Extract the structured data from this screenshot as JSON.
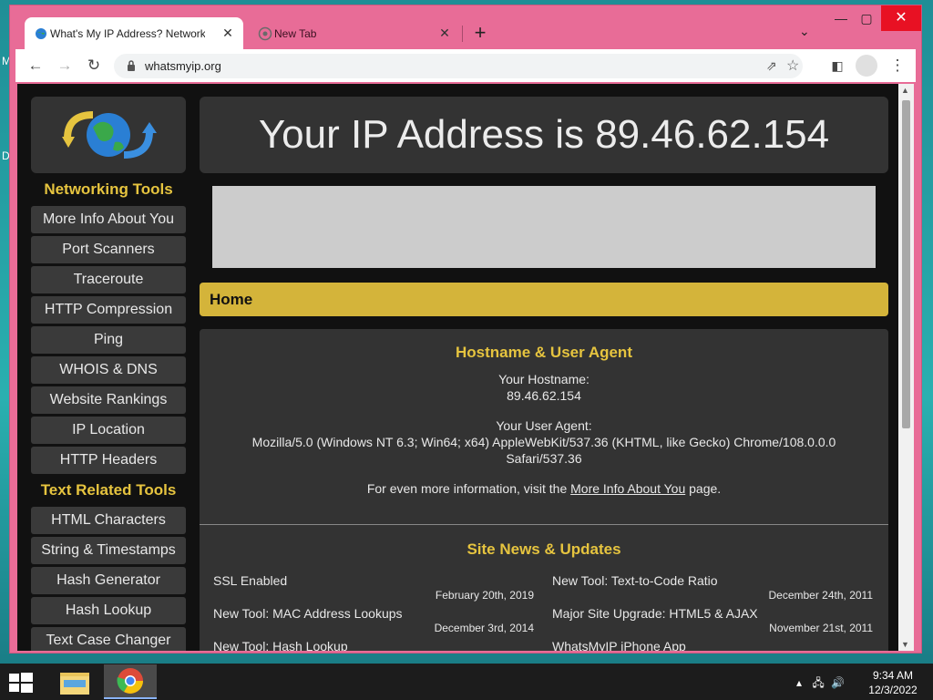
{
  "desktop": {
    "side_letters": [
      "M",
      "D"
    ]
  },
  "browser": {
    "tabs": [
      {
        "title": "What's My IP Address? Networking",
        "active": true
      },
      {
        "title": "New Tab",
        "active": false
      }
    ],
    "new_tab_label": "+",
    "url": "whatsmyip.org"
  },
  "page": {
    "ip_banner": "Your IP Address is 89.46.62.154",
    "sidebar": {
      "heading1": "Networking Tools",
      "networking_items": [
        "More Info About You",
        "Port Scanners",
        "Traceroute",
        "HTTP Compression",
        "Ping",
        "WHOIS & DNS",
        "Website Rankings",
        "IP Location",
        "HTTP Headers"
      ],
      "heading2": "Text Related Tools",
      "text_items": [
        "HTML Characters",
        "String & Timestamps",
        "Hash Generator",
        "Hash Lookup",
        "Text Case Changer"
      ]
    },
    "home_label": "Home",
    "hostname_section": {
      "heading": "Hostname & User Agent",
      "hostname_label": "Your Hostname:",
      "hostname_value": "89.46.62.154",
      "ua_label": "Your User Agent:",
      "ua_line1": "Mozilla/5.0 (Windows NT 6.3; Win64; x64) AppleWebKit/537.36 (KHTML, like Gecko) Chrome/108.0.0.0",
      "ua_line2": "Safari/537.36",
      "more_prefix": "For even more information, visit the",
      "more_link": "More Info About You",
      "more_suffix": "page."
    },
    "news": {
      "heading": "Site News & Updates",
      "left": [
        {
          "title": "SSL Enabled",
          "date": "February 20th, 2019"
        },
        {
          "title": "New Tool: MAC Address Lookups",
          "date": "December 3rd, 2014"
        },
        {
          "title": "New Tool: Hash Lookup",
          "date": ""
        }
      ],
      "right": [
        {
          "title": "New Tool: Text-to-Code Ratio",
          "date": "December 24th, 2011"
        },
        {
          "title": "Major Site Upgrade: HTML5 & AJAX",
          "date": "November 21st, 2011"
        },
        {
          "title": "WhatsMyIP iPhone App",
          "date": ""
        }
      ]
    }
  },
  "taskbar": {
    "time": "9:34 AM",
    "date": "12/3/2022"
  },
  "colors": {
    "accent_gold": "#d4b43a",
    "heading_gold": "#e6c43f",
    "frame_pink": "#e86c97",
    "close_red": "#e81123"
  }
}
